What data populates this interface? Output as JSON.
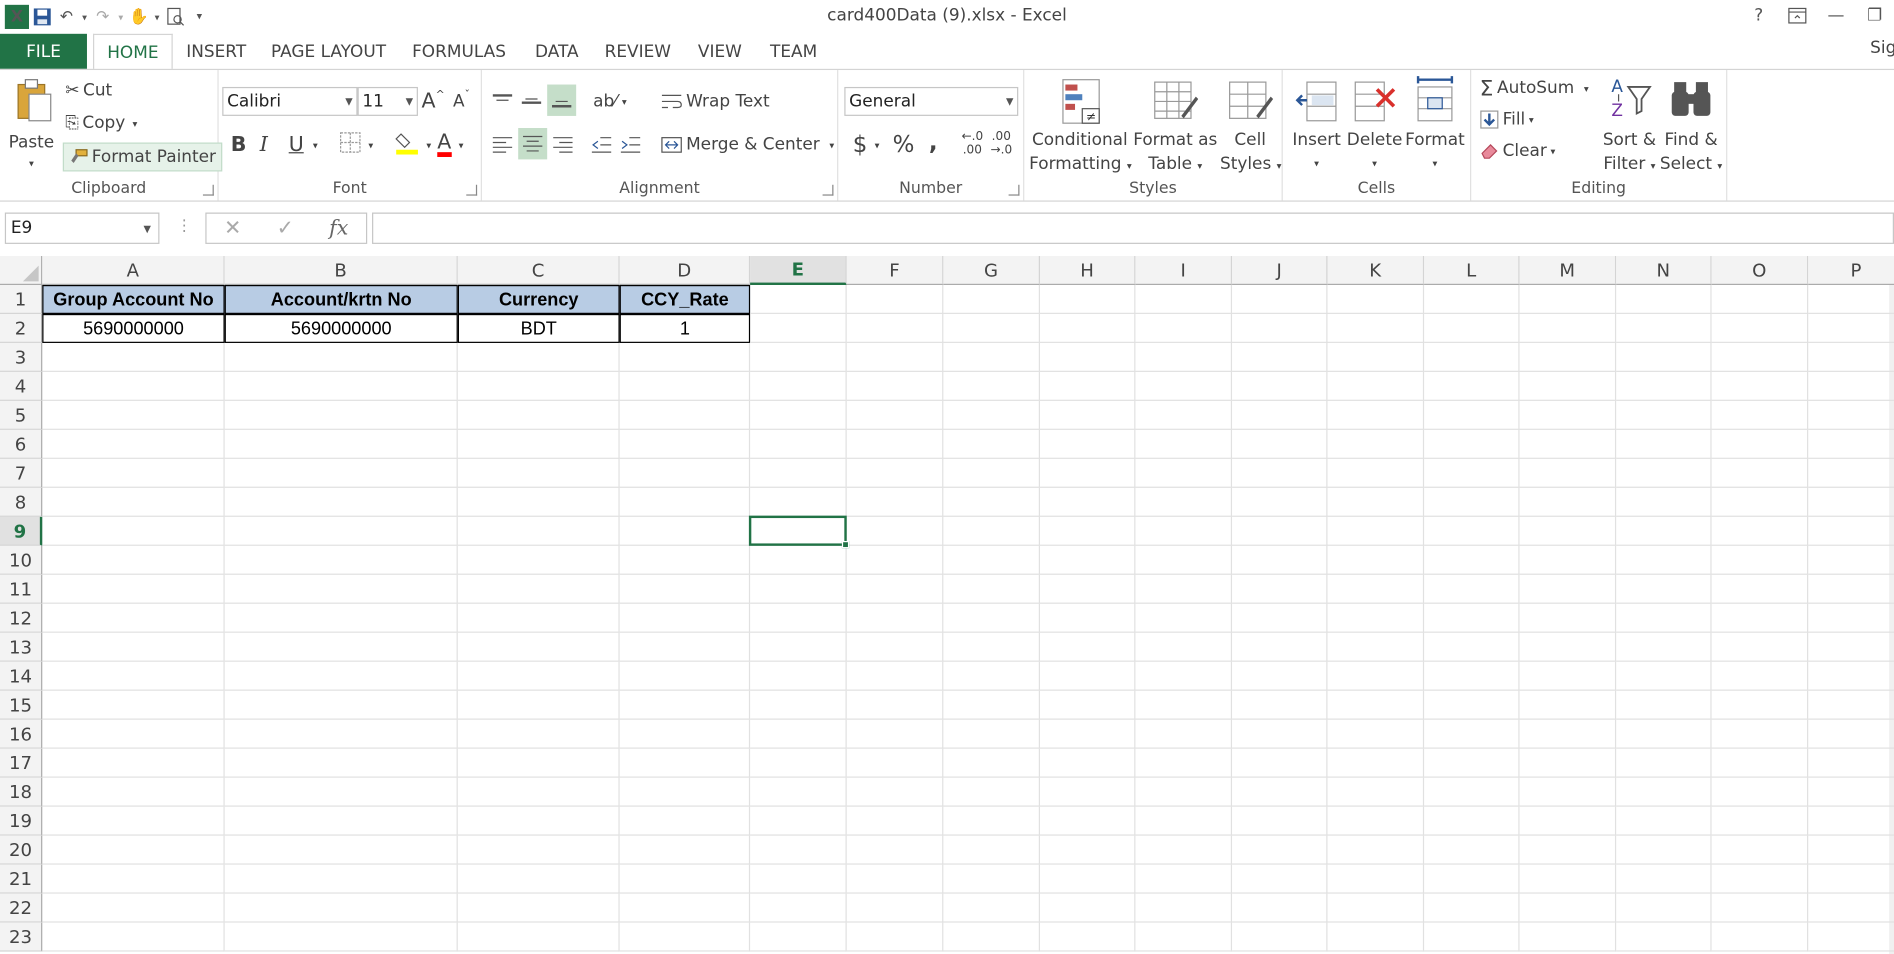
{
  "window": {
    "title": "card400Data (9).xlsx - Excel",
    "help": "?",
    "sign_in": "Sign in"
  },
  "tabs": [
    {
      "label": "FILE"
    },
    {
      "label": "HOME"
    },
    {
      "label": "INSERT"
    },
    {
      "label": "PAGE LAYOUT"
    },
    {
      "label": "FORMULAS"
    },
    {
      "label": "DATA"
    },
    {
      "label": "REVIEW"
    },
    {
      "label": "VIEW"
    },
    {
      "label": "TEAM"
    }
  ],
  "clipboard": {
    "paste": "Paste",
    "cut": "Cut",
    "copy": "Copy",
    "format_painter": "Format Painter",
    "group": "Clipboard"
  },
  "font": {
    "name": "Calibri",
    "size": "11",
    "bold": "B",
    "italic": "I",
    "underline": "U",
    "grow": "A",
    "shrink": "A",
    "font_color": "A",
    "group": "Font",
    "fill_color_hex": "#ffff00",
    "font_color_hex": "#ff0000"
  },
  "alignment": {
    "wrap_text": "Wrap Text",
    "merge_center": "Merge & Center",
    "group": "Alignment"
  },
  "number": {
    "format": "General",
    "currency": "$",
    "percent": "%",
    "comma": ",",
    "inc_decimal_top": "←.0",
    "inc_decimal_bot": ".00",
    "dec_decimal_top": ".00",
    "dec_decimal_bot": "→.0",
    "group": "Number"
  },
  "styles": {
    "conditional_1": "Conditional",
    "conditional_2": "Formatting",
    "format_table_1": "Format as",
    "format_table_2": "Table",
    "cell_styles_1": "Cell",
    "cell_styles_2": "Styles",
    "group": "Styles"
  },
  "cells_group": {
    "insert": "Insert",
    "delete": "Delete",
    "format": "Format",
    "group": "Cells"
  },
  "editing": {
    "autosum": "AutoSum",
    "fill": "Fill",
    "clear": "Clear",
    "sort_1": "Sort &",
    "sort_2": "Filter",
    "find_1": "Find &",
    "find_2": "Select",
    "group": "Editing"
  },
  "formula_bar": {
    "name_box": "E9",
    "fx": "fx",
    "formula": ""
  },
  "sheet": {
    "columns": [
      "A",
      "B",
      "C",
      "D",
      "E",
      "F",
      "G",
      "H",
      "I",
      "J",
      "K",
      "L",
      "M",
      "N",
      "O",
      "P"
    ],
    "rows": [
      "1",
      "2",
      "3",
      "4",
      "5",
      "6",
      "7",
      "8",
      "9",
      "10",
      "11",
      "12",
      "13",
      "14",
      "15",
      "16",
      "17",
      "18",
      "19",
      "20",
      "21",
      "22",
      "23"
    ],
    "selected_cell": "E9",
    "headers": [
      "Group Account No",
      "Account/krtn No",
      "Currency",
      "CCY_Rate"
    ],
    "values": [
      "5690000000",
      "5690000000",
      "BDT",
      "1"
    ],
    "header_fill": "#b8cce4",
    "accent": "#217346"
  }
}
